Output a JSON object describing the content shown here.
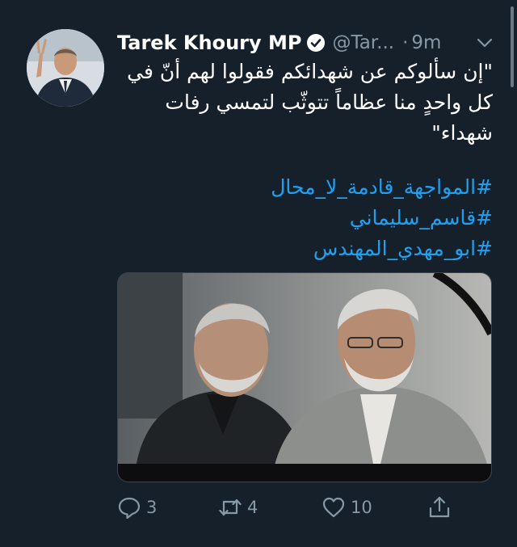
{
  "tweet": {
    "author_name": "Tarek Khoury MP",
    "handle": "@Tar...",
    "separator": "·",
    "time": "9m",
    "text_lines": [
      "\"إن سألوكم عن شهدائكم فقولوا لهم أنّ في",
      "كل واحدٍ منا عظاماً تتوثّب لتمسي رفات",
      "شهداء\""
    ],
    "hashtags": [
      "#المواجهة_قادمة_لا_محال",
      "#قاسم_سليماني",
      "#ابو_مهدي_المهندس"
    ]
  },
  "actions": {
    "reply_count": "3",
    "retweet_count": "4",
    "like_count": "10"
  },
  "icons": {
    "verified": "verified-badge-icon",
    "more": "chevron-down-icon",
    "reply": "reply-icon",
    "retweet": "retweet-icon",
    "like": "heart-icon",
    "share": "share-icon"
  },
  "colors": {
    "background": "#15202b",
    "link": "#1da1f2",
    "muted": "#8899a6"
  }
}
